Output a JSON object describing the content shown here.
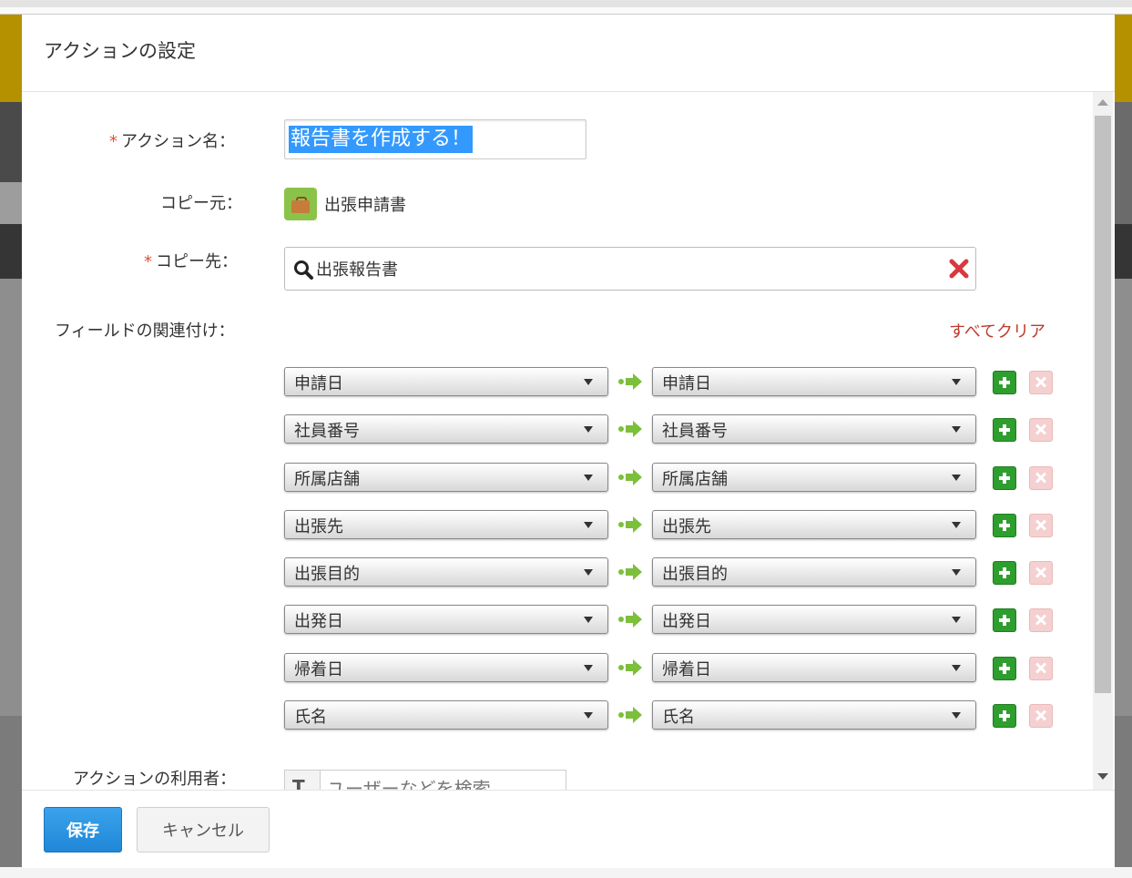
{
  "modal": {
    "title": "アクションの設定"
  },
  "form": {
    "required_mark": "*",
    "action_name_label": "アクション名：",
    "action_name_value": "報告書を作成する！",
    "copy_source_label": "コピー元：",
    "copy_source_value": "出張申請書",
    "copy_source_icon": "briefcase-icon",
    "copy_dest_label": "コピー先：",
    "copy_dest_value": "出張報告書",
    "field_mapping_label": "フィールドの関連付け：",
    "clear_all_label": "すべてクリア",
    "mappings": [
      {
        "source": "申請日",
        "dest": "申請日"
      },
      {
        "source": "社員番号",
        "dest": "社員番号"
      },
      {
        "source": "所属店舗",
        "dest": "所属店舗"
      },
      {
        "source": "出張先",
        "dest": "出張先"
      },
      {
        "source": "出張目的",
        "dest": "出張目的"
      },
      {
        "source": "出発日",
        "dest": "出発日"
      },
      {
        "source": "帰着日",
        "dest": "帰着日"
      },
      {
        "source": "氏名",
        "dest": "氏名"
      }
    ],
    "users_label": "アクションの利用者：",
    "users_placeholder": "ユーザーなどを検索"
  },
  "footer": {
    "save_label": "保存",
    "cancel_label": "キャンセル"
  },
  "colors": {
    "save_button": "#1f87d6",
    "clear_all": "#c0392b",
    "add_button": "#2e9e2e",
    "delete_button": "#f5d0d0",
    "selection": "#3399ff"
  }
}
